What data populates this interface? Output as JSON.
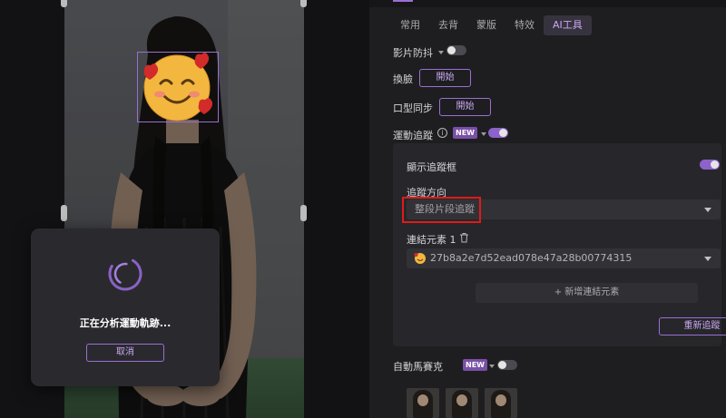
{
  "preview": {
    "loading_text": "正在分析運動軌跡...",
    "cancel_label": "取消"
  },
  "panel": {
    "tabs": [
      {
        "label": "常用",
        "active": false
      },
      {
        "label": "去背",
        "active": false
      },
      {
        "label": "蒙版",
        "active": false
      },
      {
        "label": "特效",
        "active": false
      },
      {
        "label": "AI工具",
        "active": true
      }
    ],
    "stabilize_label": "影片防抖",
    "stabilize_on": false,
    "face_swap_label": "換臉",
    "face_swap_button": "開始",
    "lip_sync_label": "口型同步",
    "lip_sync_button": "開始",
    "motion_tracking_label": "運動追蹤",
    "motion_tracking_badge": "NEW",
    "motion_tracking_on": true,
    "show_tracking_box_label": "顯示追蹤框",
    "show_tracking_box_on": true,
    "tracking_direction_label": "追蹤方向",
    "tracking_direction_value": "整段片段追蹤",
    "linked_element_label": "連結元素 1",
    "linked_element_value": "27b8a2e7d52ead078e47a28b00774315",
    "add_element_label": "+ 新增連結元素",
    "retrack_label": "重新追蹤",
    "auto_mosaic_label": "自動馬賽克",
    "auto_mosaic_badge": "NEW",
    "auto_mosaic_on": false
  },
  "icons": {
    "spinner": "loading-spinner-icon",
    "info": "info-icon",
    "trash": "trash-icon",
    "dropdown": "chevron-down-icon",
    "emoji": "smiling-face-with-hearts-emoji"
  },
  "colors": {
    "accent": "#9b6fd3",
    "highlight": "#e01a1a",
    "panel_bg": "#1e1e21"
  }
}
